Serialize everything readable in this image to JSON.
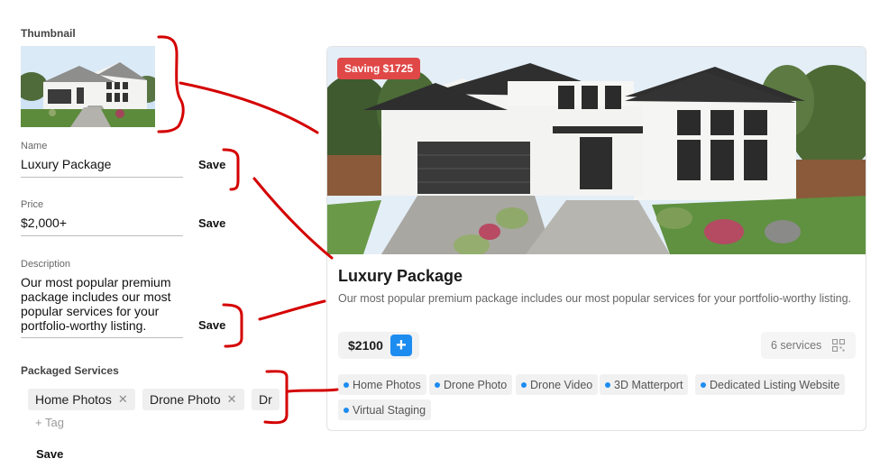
{
  "form": {
    "thumbnail_label": "Thumbnail",
    "name": {
      "label": "Name",
      "value": "Luxury Package",
      "save": "Save"
    },
    "price": {
      "label": "Price",
      "value": "$2,000+",
      "save": "Save"
    },
    "description": {
      "label": "Description",
      "lines": [
        "Our most popular premium",
        "package includes our most",
        "popular services for your",
        "portfolio-worthy listing."
      ],
      "save": "Save"
    },
    "packaged_services": {
      "label": "Packaged Services",
      "chips": [
        "Home Photos",
        "Drone Photo",
        "Dr"
      ],
      "add_tag_placeholder": "+ Tag",
      "save": "Save"
    }
  },
  "card": {
    "badge": "Saving $1725",
    "title": "Luxury Package",
    "description": "Our most popular premium package includes our most popular services for your portfolio-worthy listing.",
    "price": "$2100",
    "add_symbol": "+",
    "services_count": "6 services",
    "tags": [
      "Home Photos",
      "Drone Photo",
      "Drone Video",
      "3D Matterport",
      "Dedicated Listing Website",
      "Virtual Staging"
    ]
  },
  "colors": {
    "accent_blue": "#1d8cf0",
    "badge_red": "#e04848",
    "annotation_red": "#d40000"
  },
  "icons": {
    "chip_remove": "close-icon",
    "services": "grid-icon"
  }
}
